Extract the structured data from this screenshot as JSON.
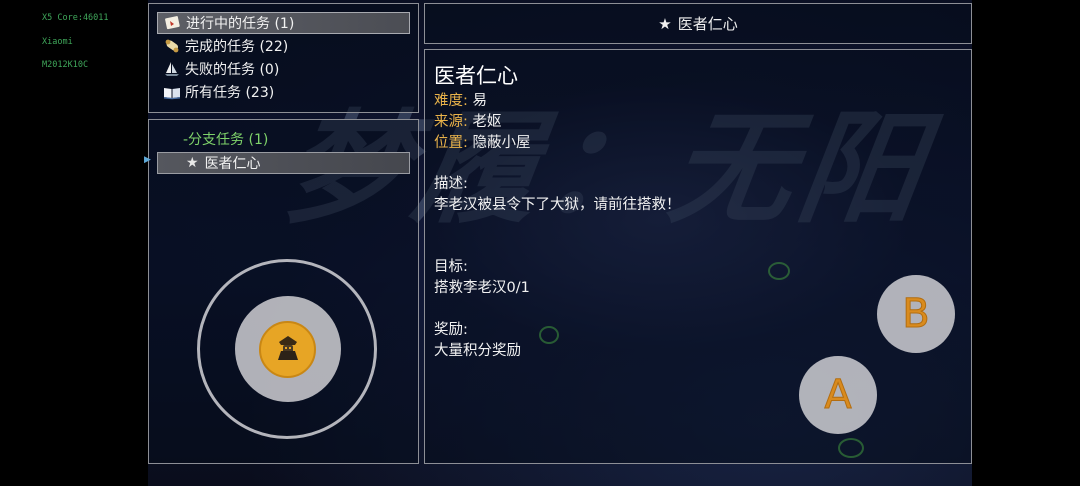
{
  "device_info": {
    "line1": "X5 Core:46011",
    "line2": "Xiaomi",
    "line3": "M2012K10C"
  },
  "background": {
    "title_art": "梦履：无阳"
  },
  "categories": [
    {
      "label": "进行中的任务 (1)",
      "icon": "scroll-card-icon",
      "selected": true
    },
    {
      "label": "完成的任务 (22)",
      "icon": "rolled-scroll-icon",
      "selected": false
    },
    {
      "label": "失败的任务 (0)",
      "icon": "sail-ship-icon",
      "selected": false
    },
    {
      "label": "所有任务 (23)",
      "icon": "open-book-icon",
      "selected": false
    }
  ],
  "quest_list": {
    "group_label": "-分支任务 (1)",
    "items": [
      {
        "label": "医者仁心",
        "icon": "star-icon",
        "selected": true
      }
    ]
  },
  "header": {
    "title": "医者仁心",
    "icon": "star-icon"
  },
  "detail": {
    "title": "医者仁心",
    "difficulty_label": "难度:",
    "difficulty_value": "易",
    "source_label": "来源:",
    "source_value": "老妪",
    "location_label": "位置:",
    "location_value": "隐蔽小屋",
    "description_label": "描述:",
    "description_value": "李老汉被县令下了大狱，请前往搭救！",
    "goal_label": "目标:",
    "goal_value": "搭救李老汉0/1",
    "reward_label": "奖励:",
    "reward_value": "大量积分奖励"
  },
  "controls": {
    "button_b": "B",
    "button_a": "A",
    "joystick_icon": "character-portrait-icon",
    "accent_color": "#e7a525"
  }
}
